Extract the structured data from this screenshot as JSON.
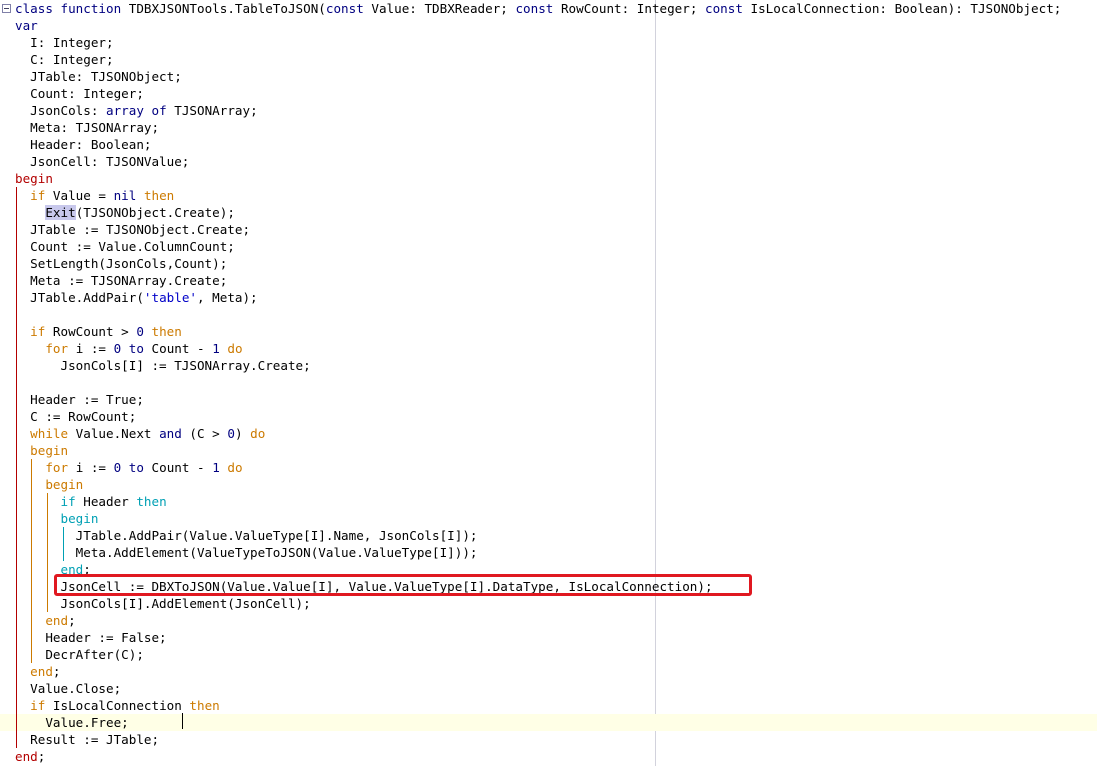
{
  "editor": {
    "lines": [
      [
        {
          "t": "class ",
          "c": "kw"
        },
        {
          "t": "function ",
          "c": "kw"
        },
        {
          "t": "TDBXJSONTools.TableToJSON("
        },
        {
          "t": "const ",
          "c": "kw"
        },
        {
          "t": "Value: TDBXReader; "
        },
        {
          "t": "const ",
          "c": "kw"
        },
        {
          "t": "RowCount: Integer; "
        },
        {
          "t": "const ",
          "c": "kw"
        },
        {
          "t": "IsLocalConnection: Boolean): TJSONObject;"
        }
      ],
      [
        {
          "t": "var",
          "c": "kw"
        }
      ],
      [
        {
          "t": "  I: Integer;"
        }
      ],
      [
        {
          "t": "  C: Integer;"
        }
      ],
      [
        {
          "t": "  JTable: TJSONObject;"
        }
      ],
      [
        {
          "t": "  Count: Integer;"
        }
      ],
      [
        {
          "t": "  JsonCols: "
        },
        {
          "t": "array of ",
          "c": "kw"
        },
        {
          "t": "TJSONArray;"
        }
      ],
      [
        {
          "t": "  Meta: TJSONArray;"
        }
      ],
      [
        {
          "t": "  Header: Boolean;"
        }
      ],
      [
        {
          "t": "  JsonCell: TJSONValue;"
        }
      ],
      [
        {
          "t": "begin",
          "c": "kwd"
        }
      ],
      [
        {
          "t": "  "
        },
        {
          "t": "if ",
          "c": "kwo"
        },
        {
          "t": "Value = "
        },
        {
          "t": "nil ",
          "c": "kw"
        },
        {
          "t": "then",
          "c": "kwo"
        }
      ],
      [
        {
          "t": "    "
        },
        {
          "t": "Exit",
          "c": "hl"
        },
        {
          "t": "(TJSONObject.Create);"
        }
      ],
      [
        {
          "t": "  JTable := TJSONObject.Create;"
        }
      ],
      [
        {
          "t": "  Count := Value.ColumnCount;"
        }
      ],
      [
        {
          "t": "  SetLength(JsonCols,Count);"
        }
      ],
      [
        {
          "t": "  Meta := TJSONArray.Create;"
        }
      ],
      [
        {
          "t": "  JTable.AddPair("
        },
        {
          "t": "'table'",
          "c": "str"
        },
        {
          "t": ", Meta);"
        }
      ],
      [],
      [
        {
          "t": "  "
        },
        {
          "t": "if ",
          "c": "kwo"
        },
        {
          "t": "RowCount > "
        },
        {
          "t": "0 ",
          "c": "num"
        },
        {
          "t": "then",
          "c": "kwo"
        }
      ],
      [
        {
          "t": "    "
        },
        {
          "t": "for ",
          "c": "kwo"
        },
        {
          "t": "i := "
        },
        {
          "t": "0 ",
          "c": "num"
        },
        {
          "t": "to ",
          "c": "kw"
        },
        {
          "t": "Count - "
        },
        {
          "t": "1 ",
          "c": "num"
        },
        {
          "t": "do",
          "c": "kwo"
        }
      ],
      [
        {
          "t": "      JsonCols[I] := TJSONArray.Create;"
        }
      ],
      [],
      [
        {
          "t": "  Header := True;"
        }
      ],
      [
        {
          "t": "  C := RowCount;"
        }
      ],
      [
        {
          "t": "  "
        },
        {
          "t": "while ",
          "c": "kwo"
        },
        {
          "t": "Value.Next "
        },
        {
          "t": "and ",
          "c": "kw"
        },
        {
          "t": "(C > "
        },
        {
          "t": "0",
          "c": "num"
        },
        {
          "t": ") "
        },
        {
          "t": "do",
          "c": "kwo"
        }
      ],
      [
        {
          "t": "  "
        },
        {
          "t": "begin",
          "c": "kwo"
        }
      ],
      [
        {
          "t": "    "
        },
        {
          "t": "for ",
          "c": "kwo"
        },
        {
          "t": "i := "
        },
        {
          "t": "0 ",
          "c": "num"
        },
        {
          "t": "to ",
          "c": "kw"
        },
        {
          "t": "Count - "
        },
        {
          "t": "1 ",
          "c": "num"
        },
        {
          "t": "do",
          "c": "kwo"
        }
      ],
      [
        {
          "t": "    "
        },
        {
          "t": "begin",
          "c": "kwo"
        }
      ],
      [
        {
          "t": "      "
        },
        {
          "t": "if ",
          "c": "kwt"
        },
        {
          "t": "Header "
        },
        {
          "t": "then",
          "c": "kwt"
        }
      ],
      [
        {
          "t": "      "
        },
        {
          "t": "begin",
          "c": "kwt"
        }
      ],
      [
        {
          "t": "        JTable.AddPair(Value.ValueType[I].Name, JsonCols[I]);"
        }
      ],
      [
        {
          "t": "        Meta.AddElement(ValueTypeToJSON(Value.ValueType[I]));"
        }
      ],
      [
        {
          "t": "      "
        },
        {
          "t": "end",
          "c": "kwt"
        },
        {
          "t": ";"
        }
      ],
      [
        {
          "t": "      JsonCell := DBXToJSON(Value.Value[I], Value.ValueType[I].DataType, IsLocalConnection);"
        }
      ],
      [
        {
          "t": "      JsonCols[I].AddElement(JsonCell);"
        }
      ],
      [
        {
          "t": "    "
        },
        {
          "t": "end",
          "c": "kwo"
        },
        {
          "t": ";"
        }
      ],
      [
        {
          "t": "    Header := False;"
        }
      ],
      [
        {
          "t": "    DecrAfter(C);"
        }
      ],
      [
        {
          "t": "  "
        },
        {
          "t": "end",
          "c": "kwo"
        },
        {
          "t": ";"
        }
      ],
      [
        {
          "t": "  Value.Close;"
        }
      ],
      [
        {
          "t": "  "
        },
        {
          "t": "if ",
          "c": "kwo"
        },
        {
          "t": "IsLocalConnection "
        },
        {
          "t": "then",
          "c": "kwo"
        }
      ],
      [
        {
          "t": "    Value.Free;"
        }
      ],
      [
        {
          "t": "  Result := JTable;"
        }
      ],
      [
        {
          "t": "end",
          "c": "kwd"
        },
        {
          "t": ";"
        }
      ]
    ],
    "current_line_index": 42,
    "highlighted_line_index": 34,
    "colors": {
      "keyword": "#000080",
      "control_keyword": "#cc7a00",
      "inner_block_keyword": "#00a0b4",
      "routine_begin_end": "#b30000",
      "string": "#0000c8",
      "highlight_box": "#e01820",
      "current_line_bg": "#ffffe6",
      "right_margin": "#d2d2dc"
    }
  }
}
